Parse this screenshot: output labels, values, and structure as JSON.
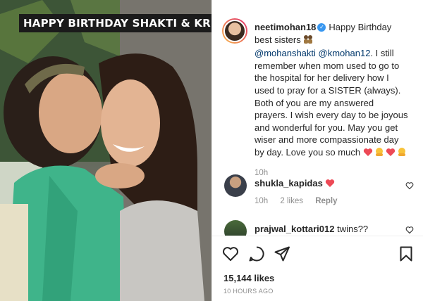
{
  "photo": {
    "overlay_text": "HAPPY BIRTHDAY SHAKTI & KRITI"
  },
  "post": {
    "author": "neetimohan18",
    "author_verified": true,
    "caption_text": "Happy Birthday best sisters",
    "mention_1": "@mohanshakti",
    "mention_2": "@kmohan12",
    "caption_body": ". I still remember when mom used to go to the hospital for her delivery how I used to pray for a SISTER (always). Both of you are my answered prayers. I wish every day to be joyous and wonderful for you. May you get wiser and more compassionate day by day. Love you so much",
    "caption_time": "10h",
    "likes": "15,144 likes",
    "posted_ago": "10 HOURS AGO"
  },
  "comments": [
    {
      "username": "shukla_kapidas",
      "text": "",
      "time": "10h",
      "likes": "2 likes",
      "reply": "Reply"
    },
    {
      "username": "prajwal_kottari012",
      "text": "twins??"
    }
  ],
  "icons": {
    "like": "heart-outline-icon",
    "comment": "comment-bubble-icon",
    "share": "paper-plane-icon",
    "save": "bookmark-icon",
    "verified": "verified-badge-icon"
  },
  "colors": {
    "mention": "#00376b",
    "verified": "#3897f0",
    "heart_emoji": "#ed4956",
    "muted_text": "#8e8e8e"
  }
}
